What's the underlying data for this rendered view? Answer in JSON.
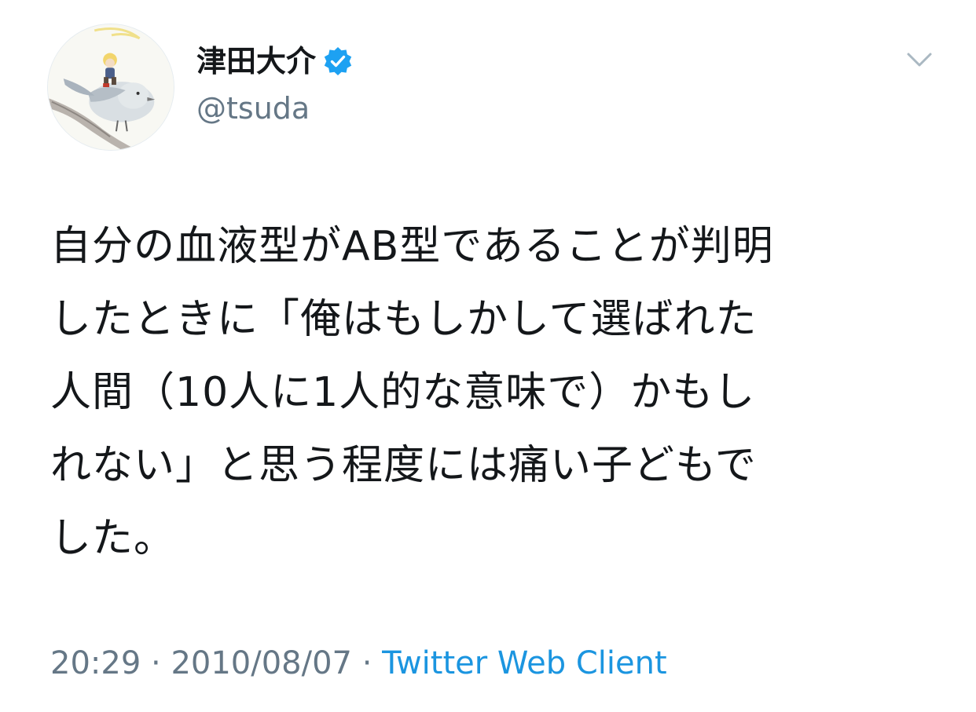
{
  "user": {
    "display_name": "津田大介",
    "handle": "@tsuda",
    "verified": true,
    "avatar_icon": "bird-illustration-avatar-icon"
  },
  "tweet": {
    "lines": [
      "自分の血液型がAB型であることが判明",
      "したときに「俺はもしかして選ばれた",
      "人間（10人に1人的な意味で）かもし",
      "れない」と思う程度には痛い子どもで",
      "した。"
    ]
  },
  "meta": {
    "time": "20:29",
    "separator": "·",
    "date": "2010/08/07",
    "source": "Twitter Web Client"
  },
  "colors": {
    "text": "#14171a",
    "secondary": "#657786",
    "link": "#1b95e0",
    "verified_badge": "#1da1f2"
  }
}
